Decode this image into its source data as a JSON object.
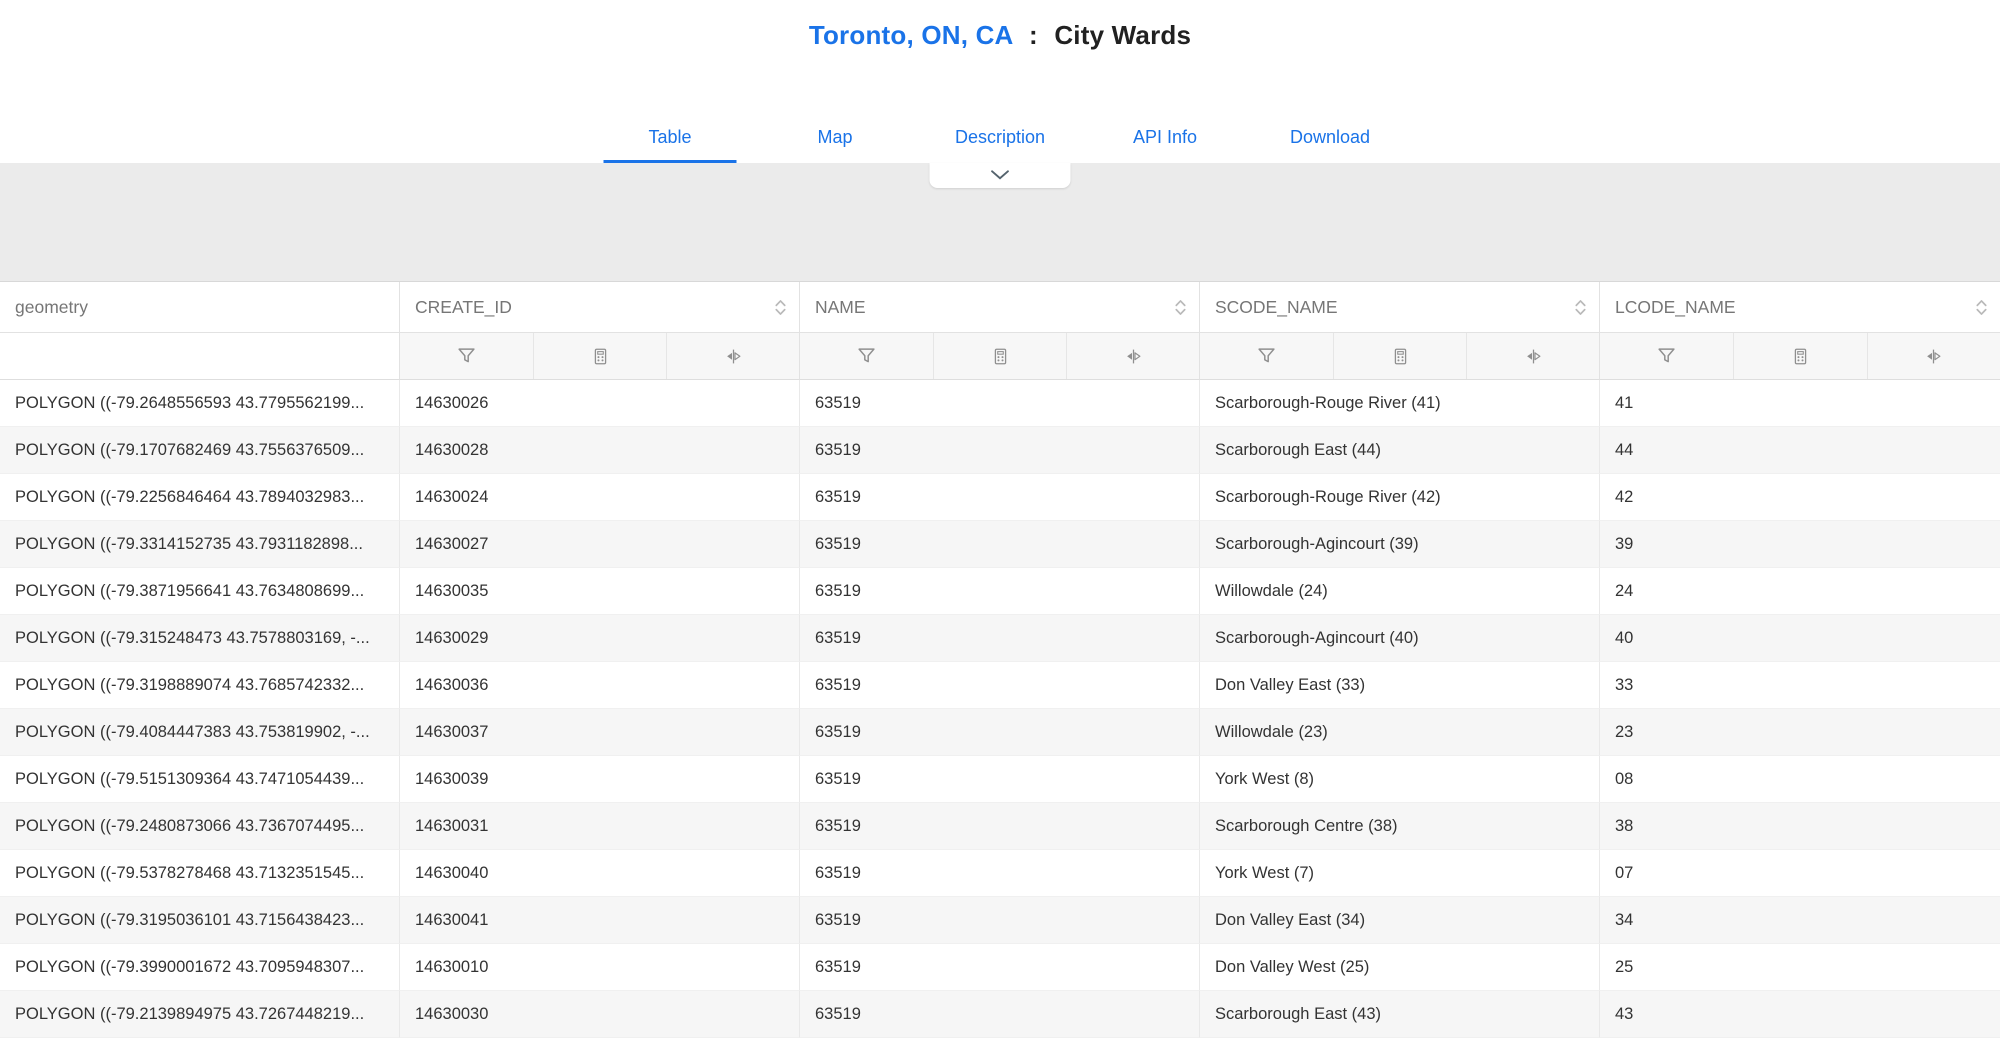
{
  "header": {
    "location_link": "Toronto, ON, CA",
    "separator": ":",
    "dataset_title": "City Wards"
  },
  "tabs": [
    {
      "label": "Table",
      "active": true
    },
    {
      "label": "Map",
      "active": false
    },
    {
      "label": "Description",
      "active": false
    },
    {
      "label": "API Info",
      "active": false
    },
    {
      "label": "Download",
      "active": false
    }
  ],
  "table": {
    "columns": [
      {
        "name": "geometry",
        "sortable": false,
        "filterable": false
      },
      {
        "name": "CREATE_ID",
        "sortable": true,
        "filterable": true
      },
      {
        "name": "NAME",
        "sortable": true,
        "filterable": true
      },
      {
        "name": "SCODE_NAME",
        "sortable": true,
        "filterable": true
      },
      {
        "name": "LCODE_NAME",
        "sortable": true,
        "filterable": true
      }
    ],
    "rows": [
      [
        "POLYGON ((-79.2648556593 43.7795562199...",
        "14630026",
        "63519",
        "Scarborough-Rouge River (41)",
        "41"
      ],
      [
        "POLYGON ((-79.1707682469 43.7556376509...",
        "14630028",
        "63519",
        "Scarborough East (44)",
        "44"
      ],
      [
        "POLYGON ((-79.2256846464 43.7894032983...",
        "14630024",
        "63519",
        "Scarborough-Rouge River (42)",
        "42"
      ],
      [
        "POLYGON ((-79.3314152735 43.7931182898...",
        "14630027",
        "63519",
        "Scarborough-Agincourt (39)",
        "39"
      ],
      [
        "POLYGON ((-79.3871956641 43.7634808699...",
        "14630035",
        "63519",
        "Willowdale (24)",
        "24"
      ],
      [
        "POLYGON ((-79.315248473 43.7578803169, -...",
        "14630029",
        "63519",
        "Scarborough-Agincourt (40)",
        "40"
      ],
      [
        "POLYGON ((-79.3198889074 43.7685742332...",
        "14630036",
        "63519",
        "Don Valley East (33)",
        "33"
      ],
      [
        "POLYGON ((-79.4084447383 43.753819902, -...",
        "14630037",
        "63519",
        "Willowdale (23)",
        "23"
      ],
      [
        "POLYGON ((-79.5151309364 43.7471054439...",
        "14630039",
        "63519",
        "York West (8)",
        "08"
      ],
      [
        "POLYGON ((-79.2480873066 43.7367074495...",
        "14630031",
        "63519",
        "Scarborough Centre (38)",
        "38"
      ],
      [
        "POLYGON ((-79.5378278468 43.7132351545...",
        "14630040",
        "63519",
        "York West (7)",
        "07"
      ],
      [
        "POLYGON ((-79.3195036101 43.7156438423...",
        "14630041",
        "63519",
        "Don Valley East (34)",
        "34"
      ],
      [
        "POLYGON ((-79.3990001672 43.7095948307...",
        "14630010",
        "63519",
        "Don Valley West (25)",
        "25"
      ],
      [
        "POLYGON ((-79.2139894975 43.7267448219...",
        "14630030",
        "63519",
        "Scarborough East (43)",
        "43"
      ]
    ]
  },
  "icons": {
    "sort": "sort-arrows-icon",
    "filter": "filter-funnel-icon",
    "aggregate": "calculator-icon",
    "compare": "compare-icon",
    "collapse": "chevron-down-icon"
  },
  "colors": {
    "accent_blue": "#1a73e8",
    "band_gray": "#ebebeb",
    "header_text_gray": "#767676",
    "row_stripe": "#f6f6f6"
  }
}
